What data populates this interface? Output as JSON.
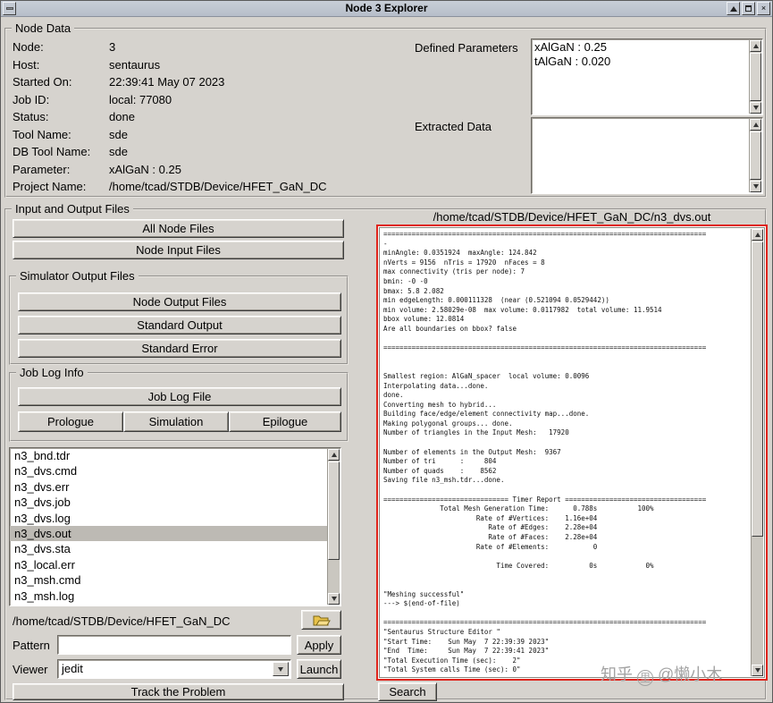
{
  "window": {
    "title": "Node 3 Explorer"
  },
  "node_data": {
    "title": "Node Data",
    "fields": [
      {
        "label": "Node:",
        "value": "3"
      },
      {
        "label": "Host:",
        "value": "sentaurus"
      },
      {
        "label": "Started On:",
        "value": "22:39:41 May 07 2023"
      },
      {
        "label": "Job ID:",
        "value": "local: 77080"
      },
      {
        "label": "Status:",
        "value": "done"
      },
      {
        "label": "Tool Name:",
        "value": "sde"
      },
      {
        "label": "DB Tool Name:",
        "value": "sde"
      },
      {
        "label": "Parameter:",
        "value": "xAlGaN : 0.25"
      },
      {
        "label": "Project Name:",
        "value": "/home/tcad/STDB/Device/HFET_GaN_DC"
      }
    ],
    "defined_parameters": {
      "label": "Defined Parameters",
      "content": "xAlGaN : 0.25\ntAlGaN : 0.020"
    },
    "extracted_data": {
      "label": "Extracted Data",
      "content": ""
    }
  },
  "io_files": {
    "title": "Input and Output Files",
    "all_node_files": "All Node Files",
    "node_input_files": "Node Input Files",
    "simulator_output": {
      "title": "Simulator Output Files",
      "node_output_files": "Node Output Files",
      "standard_output": "Standard Output",
      "standard_error": "Standard Error"
    },
    "job_log": {
      "title": "Job Log Info",
      "job_log_file": "Job Log File",
      "prologue": "Prologue",
      "simulation": "Simulation",
      "epilogue": "Epilogue"
    },
    "files": [
      "n3_bnd.tdr",
      "n3_dvs.cmd",
      "n3_dvs.err",
      "n3_dvs.job",
      "n3_dvs.log",
      "n3_dvs.out",
      "n3_dvs.sta",
      "n3_local.err",
      "n3_msh.cmd",
      "n3_msh.log"
    ],
    "selected_file": "n3_dvs.out",
    "path": "/home/tcad/STDB/Device/HFET_GaN_DC",
    "pattern": {
      "label": "Pattern",
      "value": "",
      "apply": "Apply"
    },
    "viewer": {
      "label": "Viewer",
      "value": "jedit",
      "launch": "Launch"
    },
    "track_problem": "Track the Problem"
  },
  "output_panel": {
    "header": "/home/tcad/STDB/Device/HFET_GaN_DC/n3_dvs.out",
    "search": "Search",
    "content": "================================================================================\n-\nminAngle: 0.0351924  maxAngle: 124.842\nnVerts = 9156  nTris = 17920  nFaces = 8\nmax connectivity (tris per node): 7\nbmin: -0 -0\nbmax: 5.8 2.082\nmin edgeLength: 0.000111328  (near (0.521094 0.0529442))\nmin volume: 2.58029e-08  max volume: 0.0117982  total volume: 11.9514\nbbox volume: 12.0814\nAre all boundaries on bbox? false\n\n================================================================================\n\n\nSmallest region: AlGaN_spacer  local volume: 0.0096\nInterpolating data...done.\ndone.\nConverting mesh to hybrid...\nBuilding face/edge/element connectivity map...done.\nMaking polygonal groups... done.\nNumber of triangles in the Input Mesh:   17920\n\nNumber of elements in the Output Mesh:  9367\nNumber of tri      :     804\nNumber of quads    :    8562\nSaving file n3_msh.tdr...done.\n\n=============================== Timer Report ===================================\n              Total Mesh Generation Time:      0.788s          100%\n                       Rate of #Vertices:    1.16e+04\n                          Rate of #Edges:    2.28e+04\n                          Rate of #Faces:    2.28e+04\n                       Rate of #Elements:           0\n\n                            Time Covered:          0s            0%\n\n\n\"Meshing successful\"\n---> $(end-of-file)\n\n================================================================================\n\"Sentaurus Structure Editor \"\n\"Start Time:    Sun May  7 22:39:39 2023\"\n\"End  Time:     Sun May  7 22:39:41 2023\"\n\"Total Execution Time (sec):    2\"\n\"Total System calls Time (sec): 0\""
  },
  "watermark": {
    "logo": "知乎",
    "handle": "@懒小木"
  }
}
